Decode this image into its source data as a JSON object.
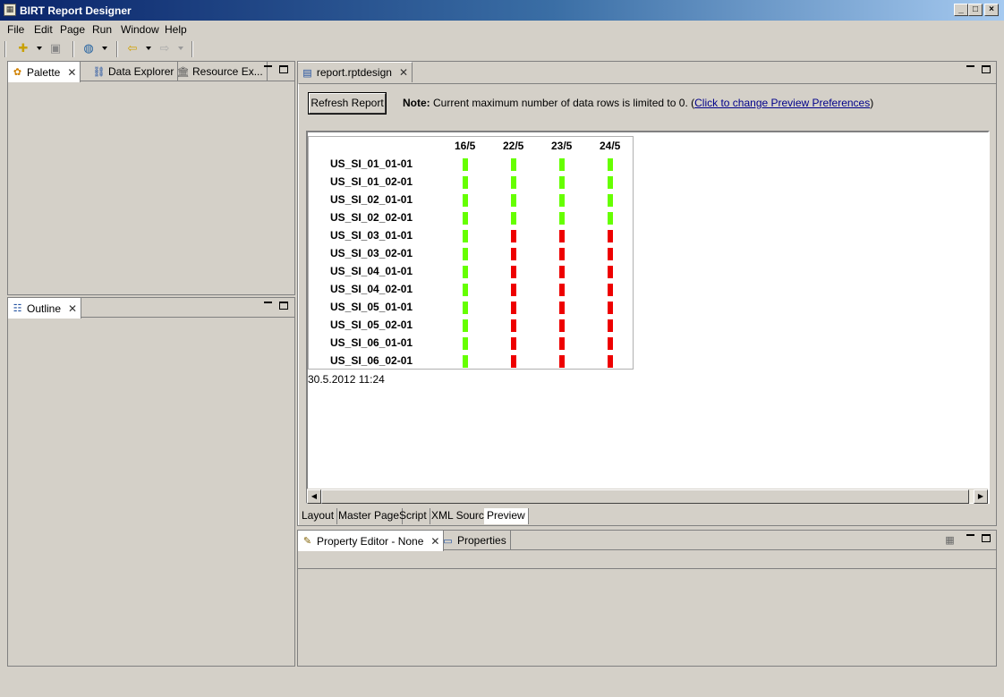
{
  "window": {
    "title": "BIRT Report Designer",
    "min": "_",
    "max": "□",
    "close": "×"
  },
  "menu": [
    "File",
    "Edit",
    "Page",
    "Run",
    "Window",
    "Help"
  ],
  "left_top_tabs": [
    "Palette",
    "Data Explorer",
    "Resource Ex..."
  ],
  "outline_tab": "Outline",
  "editor": {
    "tab": "report.rptdesign",
    "refresh_button": "Refresh Report",
    "note_bold": "Note:",
    "note_text": "Current maximum number of data rows is limited to 0. (",
    "note_link": "Click to change Preview Preferences",
    "note_end": ")",
    "timestamp": "30.5.2012 11:24",
    "bottom_tabs": [
      "Layout",
      "Master Page",
      "Script",
      "XML Source",
      "Preview"
    ]
  },
  "report": {
    "columns": [
      "16/5",
      "22/5",
      "23/5",
      "24/5"
    ],
    "rows": [
      {
        "label": "US_SI_01_01-01",
        "status": [
          "green",
          "green",
          "green",
          "green"
        ]
      },
      {
        "label": "US_SI_01_02-01",
        "status": [
          "green",
          "green",
          "green",
          "green"
        ]
      },
      {
        "label": "US_SI_02_01-01",
        "status": [
          "green",
          "green",
          "green",
          "green"
        ]
      },
      {
        "label": "US_SI_02_02-01",
        "status": [
          "green",
          "green",
          "green",
          "green"
        ]
      },
      {
        "label": "US_SI_03_01-01",
        "status": [
          "green",
          "red",
          "red",
          "red"
        ]
      },
      {
        "label": "US_SI_03_02-01",
        "status": [
          "green",
          "red",
          "red",
          "red"
        ]
      },
      {
        "label": "US_SI_04_01-01",
        "status": [
          "green",
          "red",
          "red",
          "red"
        ]
      },
      {
        "label": "US_SI_04_02-01",
        "status": [
          "green",
          "red",
          "red",
          "red"
        ]
      },
      {
        "label": "US_SI_05_01-01",
        "status": [
          "green",
          "red",
          "red",
          "red"
        ]
      },
      {
        "label": "US_SI_05_02-01",
        "status": [
          "green",
          "red",
          "red",
          "red"
        ]
      },
      {
        "label": "US_SI_06_01-01",
        "status": [
          "green",
          "red",
          "red",
          "red"
        ]
      },
      {
        "label": "US_SI_06_02-01",
        "status": [
          "green",
          "red",
          "red",
          "red"
        ]
      }
    ],
    "colors": {
      "green": "#66ff00",
      "red": "#ee0000"
    }
  },
  "bottom_tabs": [
    "Property Editor - None",
    "Properties"
  ]
}
